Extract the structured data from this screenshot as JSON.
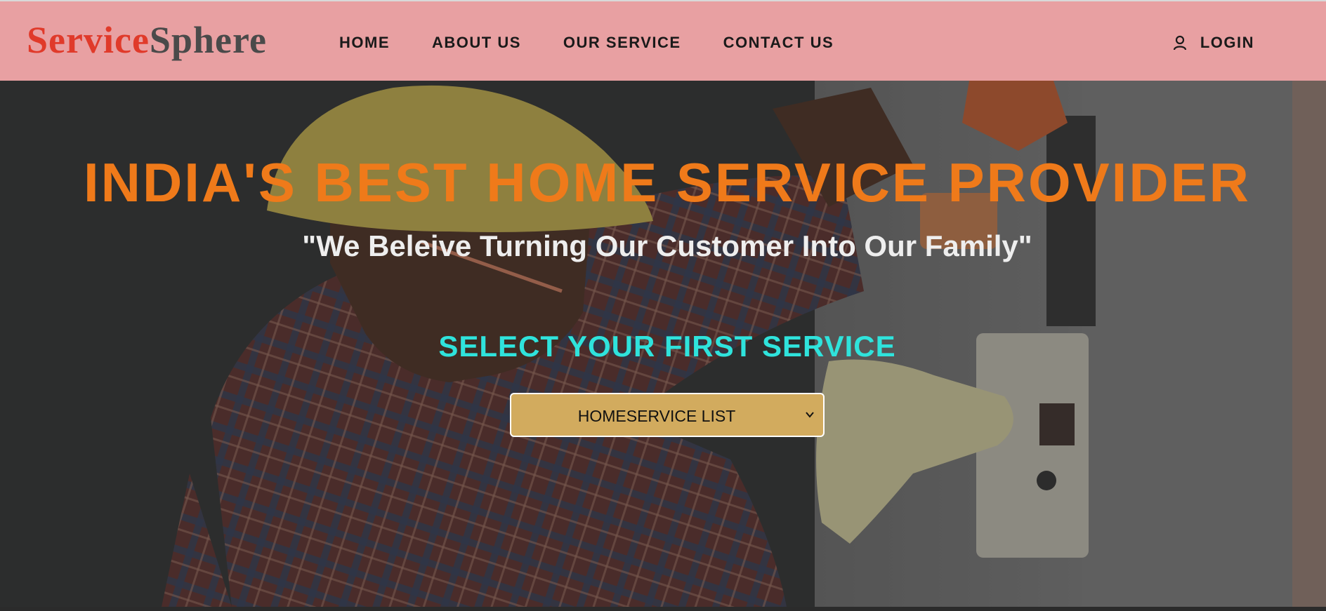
{
  "brand": {
    "part1": "Service",
    "part2": "Sphere"
  },
  "nav": {
    "items": [
      {
        "label": "HOME"
      },
      {
        "label": "ABOUT US"
      },
      {
        "label": "OUR SERVICE"
      },
      {
        "label": "CONTACT US"
      }
    ],
    "login_label": "LOGIN",
    "login_icon": "user-icon"
  },
  "hero": {
    "headline": "INDIA'S BEST HOME SERVICE PROVIDER",
    "tagline": "\"We Beleive Turning Our Customer Into Our Family\"",
    "select_title": "SELECT YOUR FIRST SERVICE",
    "select_value": "HOMESERVICE LIST"
  },
  "colors": {
    "navbar_bg": "#e8a0a2",
    "brand_red": "#e03a2a",
    "brand_gray": "#4a4a4a",
    "headline": "#ef7a1a",
    "select_title": "#2fe3dc",
    "select_bg": "#d2ab5e"
  }
}
